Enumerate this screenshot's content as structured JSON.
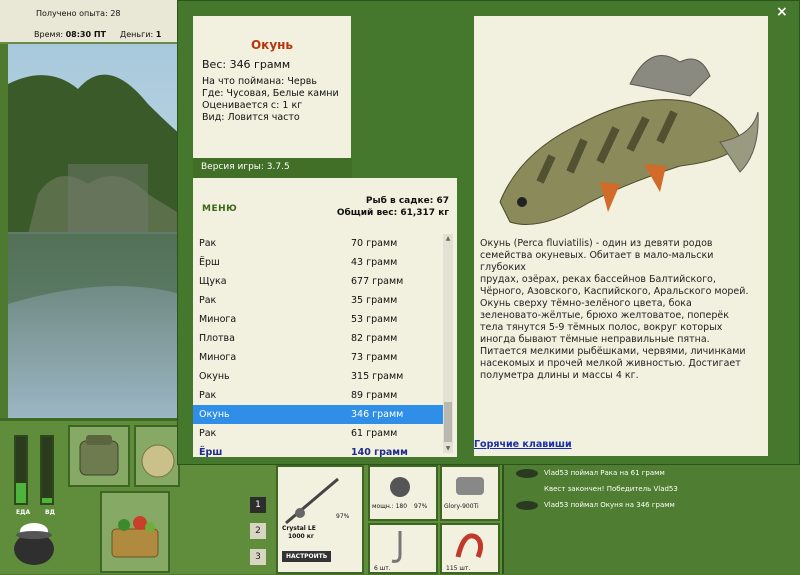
{
  "topbar": {
    "experience_label": "Получено опыта: 28",
    "time_label": "Время:",
    "time_value": "08:30 ПТ",
    "money_label": "Деньги:",
    "money_value": "1"
  },
  "meters": {
    "food_label": "ЕДА",
    "water_label": "ВД"
  },
  "fish_info": {
    "title": "Окунь",
    "weight": "Вес: 346 грамм",
    "caught_on": "На что поймана: Червь",
    "where": "Где: Чусовая, Белые камни",
    "valued_from": "Оценивается с: 1 кг",
    "kind": "Вид: Ловится часто"
  },
  "version": "Версия игры: 3.7.5",
  "stats": {
    "menu_label": "МЕНЮ",
    "in_keepnet": "Рыб в садке: 67",
    "total_weight": "Общий вес: 61,317 кг"
  },
  "catch_list": [
    {
      "name": "Рак",
      "weight": "70 грамм"
    },
    {
      "name": "Ёрш",
      "weight": "43 грамм"
    },
    {
      "name": "Щука",
      "weight": "677 грамм"
    },
    {
      "name": "Рак",
      "weight": "35 грамм"
    },
    {
      "name": "Минога",
      "weight": "53 грамм"
    },
    {
      "name": "Плотва",
      "weight": "82 грамм"
    },
    {
      "name": "Минога",
      "weight": "73 грамм"
    },
    {
      "name": "Окунь",
      "weight": "315 грамм"
    },
    {
      "name": "Рак",
      "weight": "89 грамм"
    },
    {
      "name": "Окунь",
      "weight": "346 грамм",
      "selected": true
    },
    {
      "name": "Рак",
      "weight": "61 грамм"
    },
    {
      "name": "Ёрш",
      "weight": "140 грамм",
      "bold": true
    }
  ],
  "description": {
    "text": "Окунь (Perca fluviatilis) - один из девяти родов\nсемейства окуневых. Обитает в мало-мальски глубоких\nпрудах, озёрах, реках бассейнов Балтийского,\nЧёрного, Азовского, Каспийского, Аральского морей.\nОкунь сверху тёмно-зелёного цвета, бока\nзеленовато-жёлтые, брюхо желтоватое, поперёк\nтела тянутся 5-9 тёмных полос, вокруг которых\nиногда бывают тёмные неправильные пятна.\nПитается мелкими рыбёшками, червями, личинками\nнасекомых и прочей мелкой живностью. Достигает\nполуметра длины и массы 4 кг.",
    "hotkeys_link": "Горячие клавиши"
  },
  "close_glyph": "×",
  "equipment": {
    "rod_name": "Crystal LE",
    "rod_length": "1000 кг",
    "rod_percent": "97%",
    "setup_button": "НАСТРОИТЬ",
    "reel_label": "мощн.: 180",
    "reel_percent": "97%",
    "line_label": "Glory-900Ti",
    "hooks_count": "6 шт.",
    "bait_count": "115 шт.",
    "slot_numbers": [
      "1",
      "2",
      "3"
    ]
  },
  "log": [
    "Vlad53 поймал Рака на 61 грамм",
    "Квест закончен! Победитель Vlad53",
    "Vlad53 поймал Окуня на 346 грамм"
  ]
}
